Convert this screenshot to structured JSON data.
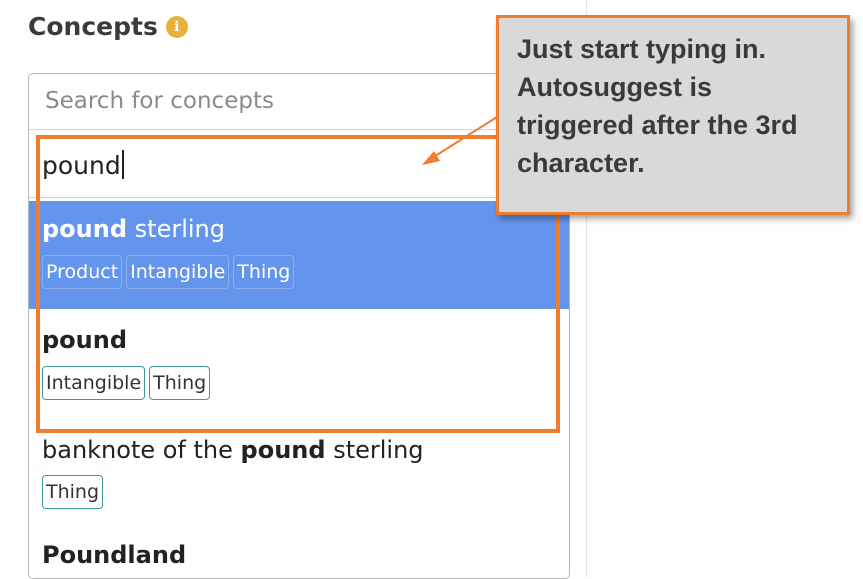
{
  "concepts": {
    "title": "Concepts",
    "info_icon": "info-icon",
    "search": {
      "placeholder": "Search for concepts",
      "typed_value": "pound"
    },
    "suggestions": [
      {
        "bold": "pound",
        "rest": " sterling",
        "tags": [
          "Product",
          "Intangible",
          "Thing"
        ],
        "selected": true
      },
      {
        "bold": "pound",
        "rest": "",
        "tags": [
          "Intangible",
          "Thing"
        ],
        "selected": false
      },
      {
        "prefix": "banknote of the ",
        "bold": "pound",
        "rest": " sterling",
        "tags": [
          "Thing"
        ],
        "selected": false
      },
      {
        "bold": "Poundland",
        "rest": "",
        "tags": [],
        "selected": false
      }
    ]
  },
  "callout": {
    "text": "Just start typing in. Autosuggest is triggered after the 3rd character."
  },
  "colors": {
    "highlight": "#ef7d2e",
    "selected_bg": "#6495ed",
    "tag_border": "#3a9a9a",
    "info_icon": "#e8b13b",
    "callout_bg": "#d9d9d9"
  }
}
